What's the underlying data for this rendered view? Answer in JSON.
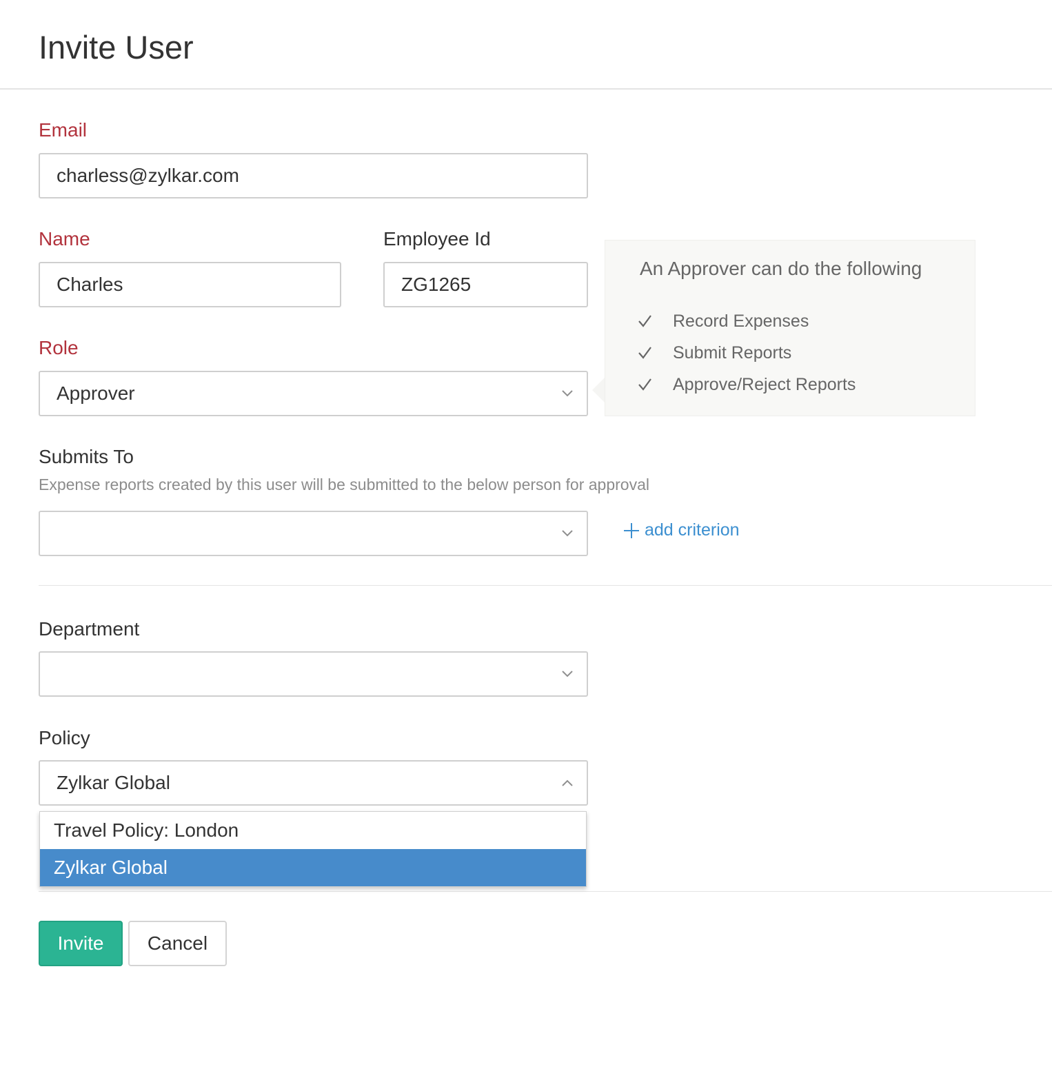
{
  "header": {
    "title": "Invite User"
  },
  "form": {
    "email": {
      "label": "Email",
      "value": "charless@zylkar.com"
    },
    "name": {
      "label": "Name",
      "value": "Charles"
    },
    "employee_id": {
      "label": "Employee Id",
      "value": "ZG1265"
    },
    "role": {
      "label": "Role",
      "value": "Approver"
    },
    "submits_to": {
      "label": "Submits To",
      "hint": "Expense reports created by this user will be submitted to the below person for approval",
      "value": "",
      "add_criterion_label": "add criterion"
    },
    "department": {
      "label": "Department",
      "value": ""
    },
    "policy": {
      "label": "Policy",
      "value": "Zylkar Global",
      "options": [
        "Travel Policy: London",
        "Zylkar Global"
      ],
      "selected_index": 1
    }
  },
  "role_info": {
    "title": "An Approver can do the following",
    "items": [
      "Record Expenses",
      "Submit Reports",
      "Approve/Reject Reports"
    ]
  },
  "actions": {
    "invite_label": "Invite",
    "cancel_label": "Cancel"
  },
  "icons": {
    "chevron_down": "chevron-down-icon",
    "chevron_up": "chevron-up-icon",
    "check": "check-icon",
    "plus": "plus-icon"
  },
  "colors": {
    "required_label": "#b2333d",
    "link": "#3c8fd0",
    "primary_button": "#2bb493",
    "selected_option": "#478bcb"
  }
}
